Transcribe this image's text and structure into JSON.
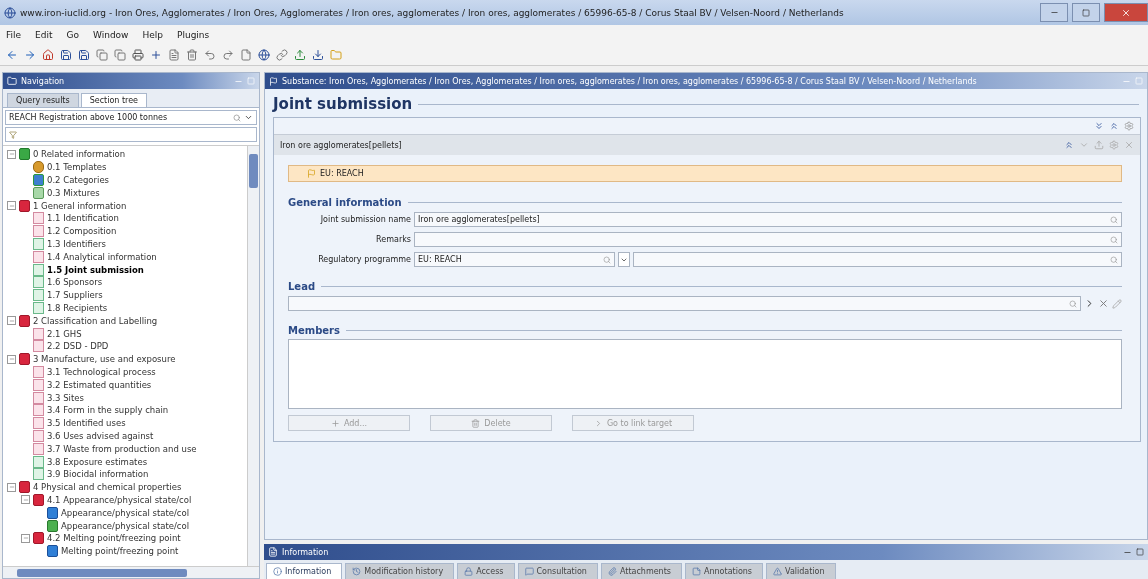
{
  "window": {
    "title": "www.iron-iuclid.org - Iron Ores, Agglomerates / Iron Ores, Agglomerates / Iron ores, agglomerates  / Iron ores, agglomerates  / 65996-65-8 / Corus Staal BV / Velsen-Noord / Netherlands"
  },
  "menu": [
    "File",
    "Edit",
    "Go",
    "Window",
    "Help",
    "Plugins"
  ],
  "navigation": {
    "title": "Navigation",
    "tabs": [
      {
        "label": "Query results",
        "selected": false
      },
      {
        "label": "Section tree",
        "selected": true
      }
    ],
    "template": "REACH Registration above 1000 tonnes",
    "tree": [
      {
        "label": "0 Related information",
        "kind": "folder-green",
        "expanded": true,
        "selected": false,
        "children": [
          {
            "label": "0.1 Templates",
            "kind": "template",
            "selected": false
          },
          {
            "label": "0.2 Categories",
            "kind": "category",
            "selected": false
          },
          {
            "label": "0.3 Mixtures",
            "kind": "mixture",
            "selected": false
          }
        ]
      },
      {
        "label": "1 General information",
        "kind": "folder-red",
        "expanded": true,
        "selected": false,
        "children": [
          {
            "label": "1.1 Identification",
            "kind": "doc-pink",
            "selected": false
          },
          {
            "label": "1.2 Composition",
            "kind": "doc-pink",
            "selected": false
          },
          {
            "label": "1.3 Identifiers",
            "kind": "doc-green",
            "selected": false
          },
          {
            "label": "1.4 Analytical information",
            "kind": "doc-pink",
            "selected": false
          },
          {
            "label": "1.5 Joint submission",
            "kind": "doc-green",
            "selected": true
          },
          {
            "label": "1.6 Sponsors",
            "kind": "doc-green",
            "selected": false
          },
          {
            "label": "1.7 Suppliers",
            "kind": "doc-green",
            "selected": false
          },
          {
            "label": "1.8 Recipients",
            "kind": "doc-green",
            "selected": false
          }
        ]
      },
      {
        "label": "2 Classification and Labelling",
        "kind": "folder-red",
        "expanded": true,
        "selected": false,
        "children": [
          {
            "label": "2.1 GHS",
            "kind": "doc-pink",
            "selected": false
          },
          {
            "label": "2.2 DSD - DPD",
            "kind": "doc-pink",
            "selected": false
          }
        ]
      },
      {
        "label": "3 Manufacture, use and exposure",
        "kind": "folder-red",
        "expanded": true,
        "selected": false,
        "children": [
          {
            "label": "3.1 Technological process",
            "kind": "doc-pink",
            "selected": false
          },
          {
            "label": "3.2 Estimated quantities",
            "kind": "doc-pink",
            "selected": false
          },
          {
            "label": "3.3 Sites",
            "kind": "doc-pink",
            "selected": false
          },
          {
            "label": "3.4 Form in the supply chain",
            "kind": "doc-pink",
            "selected": false
          },
          {
            "label": "3.5 Identified uses",
            "kind": "doc-pink",
            "selected": false
          },
          {
            "label": "3.6 Uses advised against",
            "kind": "doc-pink",
            "selected": false
          },
          {
            "label": "3.7 Waste from production and use",
            "kind": "doc-pink",
            "selected": false
          },
          {
            "label": "3.8 Exposure estimates",
            "kind": "doc-green",
            "selected": false
          },
          {
            "label": "3.9 Biocidal information",
            "kind": "doc-green",
            "selected": false
          }
        ]
      },
      {
        "label": "4 Physical and chemical properties",
        "kind": "folder-red",
        "expanded": true,
        "selected": false,
        "children": [
          {
            "label": "4.1 Appearance/physical state/col",
            "kind": "folder-red",
            "expanded": true,
            "selected": false,
            "children": [
              {
                "label": "Appearance/physical state/col",
                "kind": "record-blue",
                "selected": false
              },
              {
                "label": "Appearance/physical state/col",
                "kind": "record-green",
                "selected": false
              }
            ]
          },
          {
            "label": "4.2 Melting point/freezing point",
            "kind": "folder-red",
            "expanded": true,
            "selected": false,
            "children": [
              {
                "label": "Melting point/freezing point",
                "kind": "record-blue",
                "selected": false
              }
            ]
          }
        ]
      }
    ]
  },
  "editor": {
    "title": "Substance: Iron Ores, Agglomerates / Iron Ores, Agglomerates / Iron ores, agglomerates  / Iron ores, agglomerates  / 65996-65-8 / Corus Staal BV / Velsen-Noord / Netherlands",
    "heading": "Joint submission",
    "record": {
      "title": "Iron ore agglomerates[pellets]",
      "flag": "EU: REACH",
      "section": "General information",
      "fields": [
        {
          "label": "Joint submission name",
          "value": "Iron ore agglomerates[pellets]",
          "kind": "text"
        },
        {
          "label": "Remarks",
          "kind": "text"
        },
        {
          "label": "Regulatory programme",
          "value": "EU: REACH",
          "kind": "picklist"
        }
      ],
      "lead": "Lead",
      "members": "Members",
      "buttons": [
        {
          "label": "Add...",
          "kind": "add",
          "disabled": true
        },
        {
          "label": "Delete",
          "kind": "delete",
          "disabled": true
        },
        {
          "label": "Go to link target",
          "kind": "goto",
          "disabled": true
        }
      ]
    }
  },
  "info": {
    "title": "Information",
    "tabs": [
      {
        "label": "Information",
        "selected": true
      },
      {
        "label": "Modification history",
        "selected": false
      },
      {
        "label": "Access",
        "selected": false
      },
      {
        "label": "Consultation",
        "selected": false
      },
      {
        "label": "Attachments",
        "selected": false
      },
      {
        "label": "Annotations",
        "selected": false
      },
      {
        "label": "Validation",
        "selected": false
      }
    ]
  }
}
